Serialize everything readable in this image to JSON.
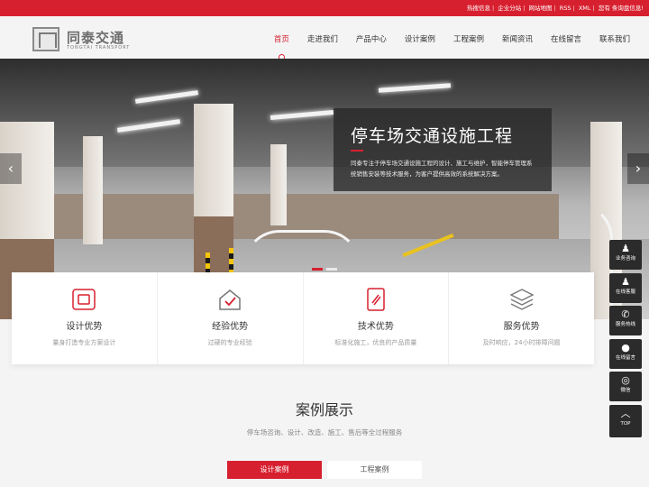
{
  "topbar": {
    "links": [
      "热搜信息",
      "企业分站",
      "网站地图",
      "RSS",
      "XML",
      "您有",
      "条询盘信息!"
    ]
  },
  "logo": {
    "cn": "同泰交通",
    "en": "TONGTAI TRANSPORT"
  },
  "nav": [
    "首页",
    "走进我们",
    "产品中心",
    "设计案例",
    "工程案例",
    "新闻资讯",
    "在线留言",
    "联系我们"
  ],
  "hero": {
    "title": "停车场交通设施工程",
    "desc": "同泰专注于停车场交通设施工程的设计、施工与维护，智能停车管理系统销售安装等技术服务，为客户提供高效的系统解决方案。",
    "prev": "‹",
    "next": "›"
  },
  "features": [
    {
      "title": "设计优势",
      "desc": "量身打造专业方案设计"
    },
    {
      "title": "经验优势",
      "desc": "过硬的专业经验"
    },
    {
      "title": "技术优势",
      "desc": "标准化施工，优良的产品质量"
    },
    {
      "title": "服务优势",
      "desc": "及时响应，24小时排障问题"
    }
  ],
  "cases": {
    "title": "案例展示",
    "subtitle": "停车场咨询、设计、改造、施工、售后等全过程服务",
    "tabs": [
      "设计案例",
      "工程案例"
    ]
  },
  "float": [
    {
      "icon": "bell-icon",
      "glyph": "♟",
      "label": "业务咨询"
    },
    {
      "icon": "bell-icon",
      "glyph": "♟",
      "label": "在线客服"
    },
    {
      "icon": "phone-icon",
      "glyph": "✆",
      "label": "服务热线"
    },
    {
      "icon": "chat-icon",
      "glyph": "●",
      "label": "在线留言"
    },
    {
      "icon": "wechat-icon",
      "glyph": "◎",
      "label": "微信"
    },
    {
      "icon": "up-arrow-icon",
      "glyph": "︿",
      "label": "TOP"
    }
  ],
  "colors": {
    "accent": "#d7202f",
    "dark": "#2b2b2b"
  }
}
